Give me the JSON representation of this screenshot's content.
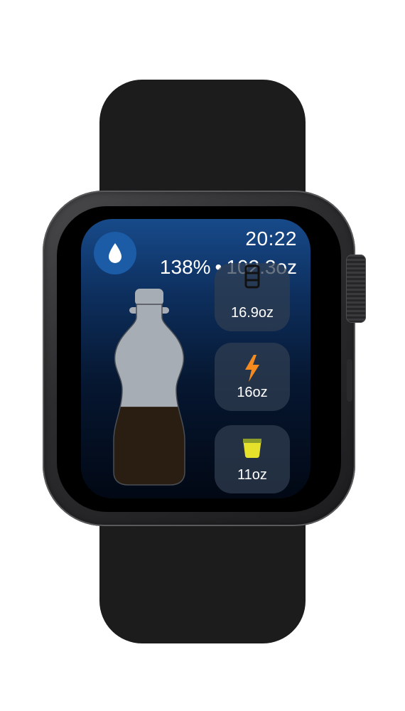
{
  "status": {
    "time": "20:22",
    "percent": "138%",
    "separator": "•",
    "amount": "102.3oz"
  },
  "bottle": {
    "fill_fraction": 0.47,
    "liquid_color": "#2a1d12",
    "empty_color": "#a7adb4"
  },
  "drinks": [
    {
      "label": "16.9oz",
      "icon": "bottle-icon",
      "color": "#111111"
    },
    {
      "label": "16oz",
      "icon": "lightning-bolt-icon",
      "color": "#f58a1f"
    },
    {
      "label": "11oz",
      "icon": "cup-icon",
      "color": "#e6e12a"
    }
  ],
  "colors": {
    "drop_button": "#1c5ba5",
    "screen_top": "#174a8a",
    "screen_bottom": "#020814"
  }
}
